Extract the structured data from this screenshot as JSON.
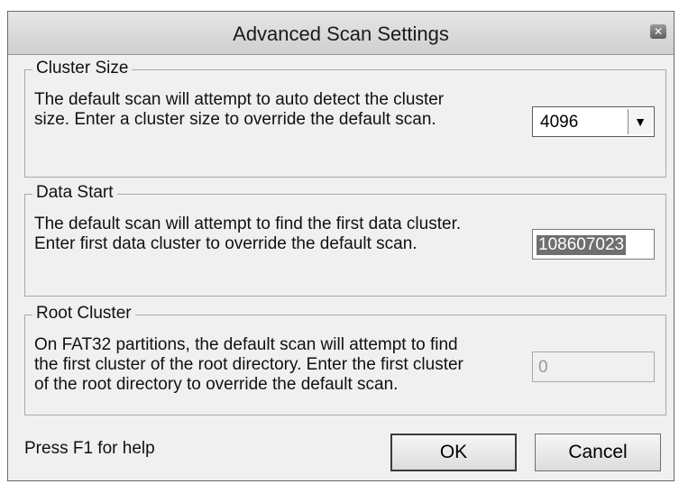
{
  "window": {
    "title": "Advanced Scan Settings"
  },
  "cluster_size": {
    "legend": "Cluster Size",
    "description": "The default scan will attempt to auto detect the cluster\nsize.  Enter a cluster size to override the default scan.",
    "selected_value": "4096"
  },
  "data_start": {
    "legend": "Data Start",
    "description": "The default scan will attempt to find the first data cluster.\nEnter first data cluster to override the default scan.",
    "value": "108607023"
  },
  "root_cluster": {
    "legend": "Root Cluster",
    "description": "On FAT32 partitions, the default scan will attempt to find\nthe first cluster of the root directory.  Enter the first cluster\nof the root directory to override the default scan.",
    "value": "0"
  },
  "footer": {
    "help_text": "Press F1 for help",
    "ok_label": "OK",
    "cancel_label": "Cancel"
  }
}
